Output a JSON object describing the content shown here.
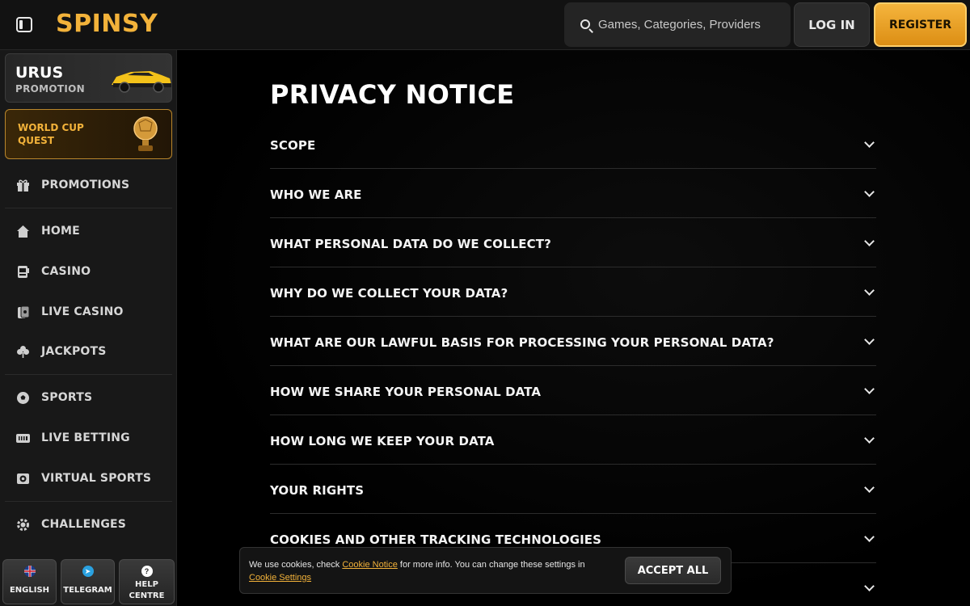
{
  "header": {
    "logo_text": "SPINSY",
    "search_placeholder": "Games, Categories, Providers",
    "login_label": "LOG IN",
    "register_label": "REGISTER",
    "brand_color": "#f2b23a"
  },
  "sidebar": {
    "promo_cards": [
      {
        "title": "URUS",
        "subtitle": "PROMOTION"
      },
      {
        "title": "WORLD CUP QUEST"
      }
    ],
    "items": [
      {
        "label": "PROMOTIONS",
        "icon": "gift-icon"
      },
      {
        "label": "HOME",
        "icon": "home-icon"
      },
      {
        "label": "CASINO",
        "icon": "slot-machine-icon"
      },
      {
        "label": "LIVE CASINO",
        "icon": "cards-icon"
      },
      {
        "label": "JACKPOTS",
        "icon": "clover-icon"
      },
      {
        "label": "SPORTS",
        "icon": "football-icon"
      },
      {
        "label": "LIVE BETTING",
        "icon": "live-badge-icon"
      },
      {
        "label": "VIRTUAL SPORTS",
        "icon": "virtual-ball-icon"
      },
      {
        "label": "CHALLENGES",
        "icon": "gear-badge-icon"
      }
    ],
    "bottom_buttons": [
      {
        "label": "ENGLISH",
        "icon": "uk-flag-icon"
      },
      {
        "label": "TELEGRAM",
        "icon": "telegram-icon"
      },
      {
        "label": "HELP CENTRE",
        "label_line1": "HELP",
        "label_line2": "CENTRE",
        "icon": "question-icon"
      }
    ]
  },
  "main": {
    "title": "PRIVACY NOTICE",
    "sections": [
      "SCOPE",
      "WHO WE ARE",
      "WHAT PERSONAL DATA DO WE COLLECT?",
      "WHY DO WE COLLECT YOUR DATA?",
      "WHAT ARE OUR LAWFUL BASIS FOR PROCESSING YOUR PERSONAL DATA?",
      "HOW WE SHARE YOUR PERSONAL DATA",
      "HOW LONG WE KEEP YOUR DATA",
      "YOUR RIGHTS",
      "COOKIES AND OTHER TRACKING TECHNOLOGIES",
      ""
    ]
  },
  "cookie_banner": {
    "text_1": "We use cookies, check ",
    "link_1": "Cookie Notice",
    "text_2": " for more info. You can change these settings in ",
    "link_2": "Cookie Settings",
    "accept_label": "ACCEPT ALL"
  }
}
